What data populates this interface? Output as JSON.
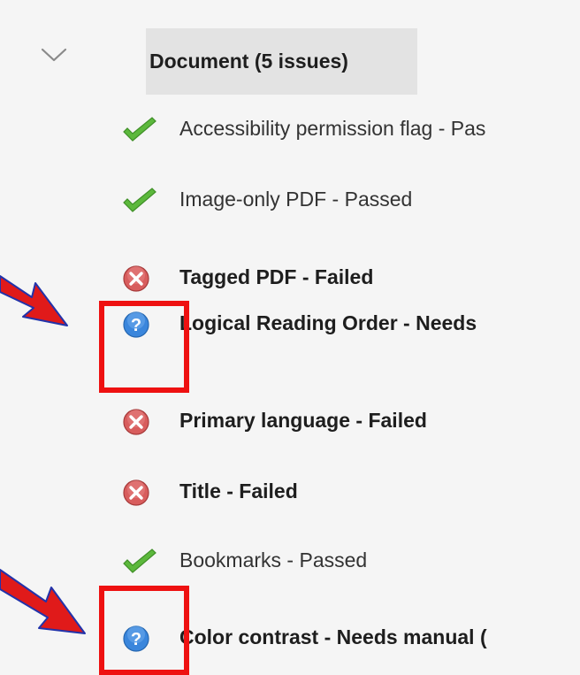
{
  "panel": {
    "section_title": "Document (5 issues)",
    "expand_icon": "chevron-down-icon"
  },
  "rules": [
    {
      "label": "Accessibility permission flag - Pas",
      "status": "passed",
      "icon": "check-icon",
      "emphasis": "normal"
    },
    {
      "label": "Image-only PDF - Passed",
      "status": "passed",
      "icon": "check-icon",
      "emphasis": "normal"
    },
    {
      "label": "Tagged PDF - Failed",
      "status": "failed",
      "icon": "failed-icon",
      "emphasis": "bold"
    },
    {
      "label": "Logical Reading Order - Needs",
      "status": "needs-manual-check",
      "icon": "question-icon",
      "emphasis": "bold"
    },
    {
      "label": "Primary language - Failed",
      "status": "failed",
      "icon": "failed-icon",
      "emphasis": "bold"
    },
    {
      "label": "Title - Failed",
      "status": "failed",
      "icon": "failed-icon",
      "emphasis": "bold"
    },
    {
      "label": "Bookmarks - Passed",
      "status": "passed",
      "icon": "check-icon",
      "emphasis": "normal"
    },
    {
      "label": "Color contrast - Needs manual (",
      "status": "needs-manual-check",
      "icon": "question-icon",
      "emphasis": "bold"
    }
  ],
  "annotations": {
    "highlight_color": "#ee1111",
    "arrow_color": "#e01a1a",
    "arrow_outline_color": "#2233aa",
    "highlighted_rules": [
      "Logical Reading Order",
      "Color contrast"
    ]
  },
  "colors": {
    "background": "#f5f5f5",
    "header_background": "#e3e3e3",
    "passed": "#5cb83c",
    "failed": "#c94a4a",
    "needs_check": "#2f7fd8"
  }
}
